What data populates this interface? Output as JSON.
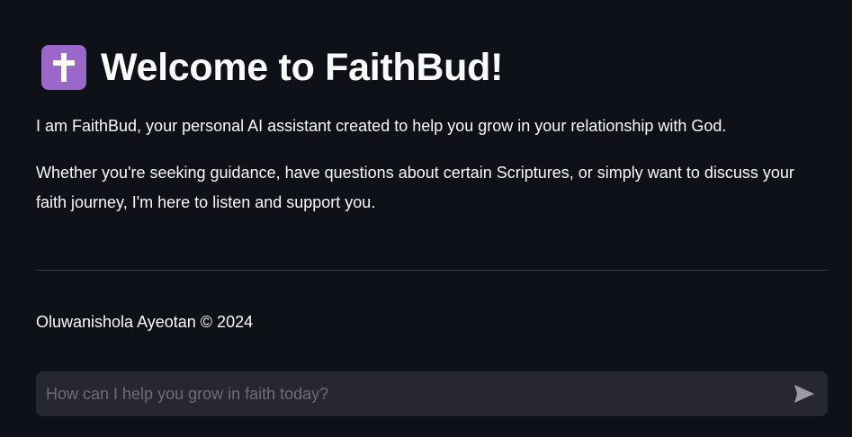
{
  "header": {
    "icon": "latin-cross-icon",
    "icon_color": "#9b67c9",
    "title": "Welcome to FaithBud!"
  },
  "intro": {
    "paragraph_1": "I am FaithBud, your personal AI assistant created to help you grow in your relationship with God.",
    "paragraph_2": "Whether you're seeking guidance, have questions about certain Scriptures, or simply want to discuss your faith journey, I'm here to listen and support you."
  },
  "footer": {
    "credit": "Oluwanishola Ayeotan © 2024"
  },
  "chat": {
    "placeholder": "How can I help you grow in faith today?",
    "value": "",
    "send_icon": "send-arrow-icon"
  },
  "colors": {
    "background": "#0e1117",
    "text": "#fafafa",
    "input_background": "#262730",
    "divider": "#3a3d45"
  }
}
